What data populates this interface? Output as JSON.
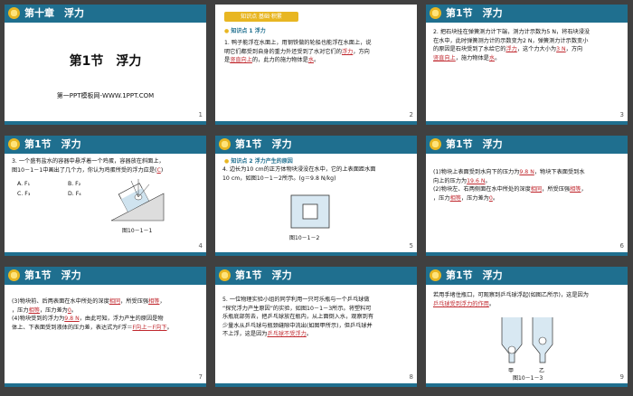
{
  "slides": [
    {
      "num": "1",
      "chapter": "第十章　浮力",
      "title": "第1节　浮力",
      "subtitle": "第一PPT模板网-WWW.1PPT.COM"
    },
    {
      "num": "2",
      "banner": "知识点 基础·积累",
      "section": "知识点 1 浮力",
      "lines": [
        "1. 鸭子能浮在水面上，用钢铁做的轮船也能浮在水面上，说",
        "明它们都受到自身的重力外还受到了水对它们的",
        "是",
        "的，此力的施力物体是"
      ],
      "ans": [
        "浮力",
        "竖直向上",
        "水"
      ],
      "tail": [
        "，方向",
        "。"
      ]
    },
    {
      "num": "3",
      "header": "第1节　浮力",
      "lines": [
        "2. 把石块挂在弹簧测力计下端，测力计示数为5 N，将石块浸没",
        "在水中，此时弹簧测力计的示数变为2 N，弹簧测力计示数变小",
        "的原因是石块受到了水给它的",
        "，这个力大小为",
        "，方向",
        "，施力物体是"
      ],
      "ans": [
        "浮力",
        "3 N",
        "竖直向上",
        "水"
      ]
    },
    {
      "num": "4",
      "header": "第1节　浮力",
      "lines": [
        "3. 一个盛有盐水的容器中悬浮着一个鸡蛋，容器放在斜面上，",
        "图10－1－1中画出了几个力，你认为鸡蛋所受的浮力应是("
      ],
      "ans": "C",
      "close": ")",
      "options": [
        "A. F₁",
        "B. F₂",
        "C. F₃",
        "D. F₄"
      ],
      "figure": "图10－1－1"
    },
    {
      "num": "5",
      "header": "第1节　浮力",
      "section": "知识点 2 浮力产生的原因",
      "lines": [
        "4. 边长为10 cm的正方体物块浸没在水中，它的上表面距水面",
        "10 cm，如图10－1－2所示。(g＝9.8 N/kg)"
      ],
      "figure": "图10－1－2"
    },
    {
      "num": "6",
      "header": "第1节　浮力",
      "lines": [
        "(1)物块上表面受到水向下的压力为",
        "，物块下表面受到水",
        "向上的压力为",
        "。",
        "(2)物块左、右两侧面在水中所处的深度",
        "，所受压强",
        "，压力",
        "，压力差为"
      ],
      "ans": [
        "9.8 N",
        "19.6 N",
        "相同",
        "相等",
        "相等",
        "0"
      ]
    },
    {
      "num": "7",
      "header": "第1节　浮力",
      "lines": [
        "(3)物块前、后两表面在水中所处的深度",
        "，所受压强",
        "，压力",
        "，压力差为",
        "(4)物块受到的浮力为",
        "，由此可知，浮力产生的原因是物",
        "体上、下表面受到液体的压力差，表达式为F浮＝"
      ],
      "ans": [
        "相同",
        "相等",
        "相等",
        "0",
        "9.8 N",
        "F向上－F向下"
      ]
    },
    {
      "num": "8",
      "header": "第1节　浮力",
      "lines": [
        "5. 一位物理实验小组的同学利用一只可乐瓶与一个乒乓球做",
        "“探究浮力产生原因”的实验，如图10－1－3所示。将塑料可",
        "乐瓶底部剪去，把乒乓球放在瓶内，从上面倒入水，观察到有",
        "少量水从乒乓球与瓶颈缝隙中流出(如图甲所示)，但乒乓球并",
        "不上浮，这是因为"
      ],
      "ans": "乒乓球不受浮力"
    },
    {
      "num": "9",
      "header": "第1节　浮力",
      "lines": [
        "若用手堵住瓶口，可观察到乒乓球浮起(如图乙所示)，这是因为",
        "。"
      ],
      "ans": "乒乓球受到浮力的作用",
      "figure": "图10－1－3",
      "labels": [
        "甲",
        "乙"
      ]
    }
  ]
}
